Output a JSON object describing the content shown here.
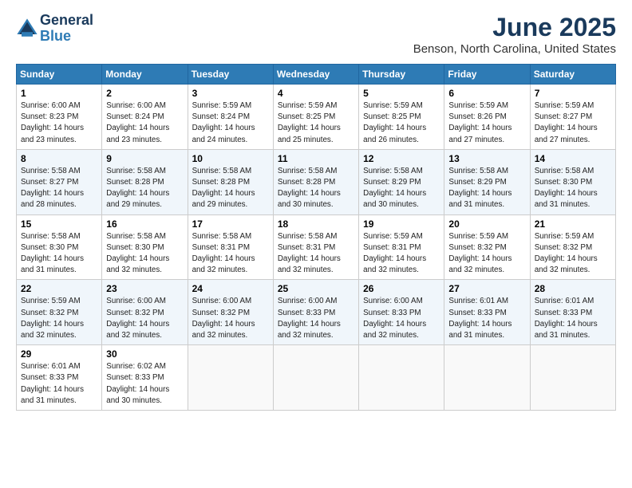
{
  "header": {
    "logo_line1": "General",
    "logo_line2": "Blue",
    "title": "June 2025",
    "subtitle": "Benson, North Carolina, United States"
  },
  "weekdays": [
    "Sunday",
    "Monday",
    "Tuesday",
    "Wednesday",
    "Thursday",
    "Friday",
    "Saturday"
  ],
  "weeks": [
    [
      {
        "day": "1",
        "info": "Sunrise: 6:00 AM\nSunset: 8:23 PM\nDaylight: 14 hours\nand 23 minutes."
      },
      {
        "day": "2",
        "info": "Sunrise: 6:00 AM\nSunset: 8:24 PM\nDaylight: 14 hours\nand 23 minutes."
      },
      {
        "day": "3",
        "info": "Sunrise: 5:59 AM\nSunset: 8:24 PM\nDaylight: 14 hours\nand 24 minutes."
      },
      {
        "day": "4",
        "info": "Sunrise: 5:59 AM\nSunset: 8:25 PM\nDaylight: 14 hours\nand 25 minutes."
      },
      {
        "day": "5",
        "info": "Sunrise: 5:59 AM\nSunset: 8:25 PM\nDaylight: 14 hours\nand 26 minutes."
      },
      {
        "day": "6",
        "info": "Sunrise: 5:59 AM\nSunset: 8:26 PM\nDaylight: 14 hours\nand 27 minutes."
      },
      {
        "day": "7",
        "info": "Sunrise: 5:59 AM\nSunset: 8:27 PM\nDaylight: 14 hours\nand 27 minutes."
      }
    ],
    [
      {
        "day": "8",
        "info": "Sunrise: 5:58 AM\nSunset: 8:27 PM\nDaylight: 14 hours\nand 28 minutes."
      },
      {
        "day": "9",
        "info": "Sunrise: 5:58 AM\nSunset: 8:28 PM\nDaylight: 14 hours\nand 29 minutes."
      },
      {
        "day": "10",
        "info": "Sunrise: 5:58 AM\nSunset: 8:28 PM\nDaylight: 14 hours\nand 29 minutes."
      },
      {
        "day": "11",
        "info": "Sunrise: 5:58 AM\nSunset: 8:28 PM\nDaylight: 14 hours\nand 30 minutes."
      },
      {
        "day": "12",
        "info": "Sunrise: 5:58 AM\nSunset: 8:29 PM\nDaylight: 14 hours\nand 30 minutes."
      },
      {
        "day": "13",
        "info": "Sunrise: 5:58 AM\nSunset: 8:29 PM\nDaylight: 14 hours\nand 31 minutes."
      },
      {
        "day": "14",
        "info": "Sunrise: 5:58 AM\nSunset: 8:30 PM\nDaylight: 14 hours\nand 31 minutes."
      }
    ],
    [
      {
        "day": "15",
        "info": "Sunrise: 5:58 AM\nSunset: 8:30 PM\nDaylight: 14 hours\nand 31 minutes."
      },
      {
        "day": "16",
        "info": "Sunrise: 5:58 AM\nSunset: 8:30 PM\nDaylight: 14 hours\nand 32 minutes."
      },
      {
        "day": "17",
        "info": "Sunrise: 5:58 AM\nSunset: 8:31 PM\nDaylight: 14 hours\nand 32 minutes."
      },
      {
        "day": "18",
        "info": "Sunrise: 5:58 AM\nSunset: 8:31 PM\nDaylight: 14 hours\nand 32 minutes."
      },
      {
        "day": "19",
        "info": "Sunrise: 5:59 AM\nSunset: 8:31 PM\nDaylight: 14 hours\nand 32 minutes."
      },
      {
        "day": "20",
        "info": "Sunrise: 5:59 AM\nSunset: 8:32 PM\nDaylight: 14 hours\nand 32 minutes."
      },
      {
        "day": "21",
        "info": "Sunrise: 5:59 AM\nSunset: 8:32 PM\nDaylight: 14 hours\nand 32 minutes."
      }
    ],
    [
      {
        "day": "22",
        "info": "Sunrise: 5:59 AM\nSunset: 8:32 PM\nDaylight: 14 hours\nand 32 minutes."
      },
      {
        "day": "23",
        "info": "Sunrise: 6:00 AM\nSunset: 8:32 PM\nDaylight: 14 hours\nand 32 minutes."
      },
      {
        "day": "24",
        "info": "Sunrise: 6:00 AM\nSunset: 8:32 PM\nDaylight: 14 hours\nand 32 minutes."
      },
      {
        "day": "25",
        "info": "Sunrise: 6:00 AM\nSunset: 8:33 PM\nDaylight: 14 hours\nand 32 minutes."
      },
      {
        "day": "26",
        "info": "Sunrise: 6:00 AM\nSunset: 8:33 PM\nDaylight: 14 hours\nand 32 minutes."
      },
      {
        "day": "27",
        "info": "Sunrise: 6:01 AM\nSunset: 8:33 PM\nDaylight: 14 hours\nand 31 minutes."
      },
      {
        "day": "28",
        "info": "Sunrise: 6:01 AM\nSunset: 8:33 PM\nDaylight: 14 hours\nand 31 minutes."
      }
    ],
    [
      {
        "day": "29",
        "info": "Sunrise: 6:01 AM\nSunset: 8:33 PM\nDaylight: 14 hours\nand 31 minutes."
      },
      {
        "day": "30",
        "info": "Sunrise: 6:02 AM\nSunset: 8:33 PM\nDaylight: 14 hours\nand 30 minutes."
      },
      {
        "day": "",
        "info": ""
      },
      {
        "day": "",
        "info": ""
      },
      {
        "day": "",
        "info": ""
      },
      {
        "day": "",
        "info": ""
      },
      {
        "day": "",
        "info": ""
      }
    ]
  ]
}
